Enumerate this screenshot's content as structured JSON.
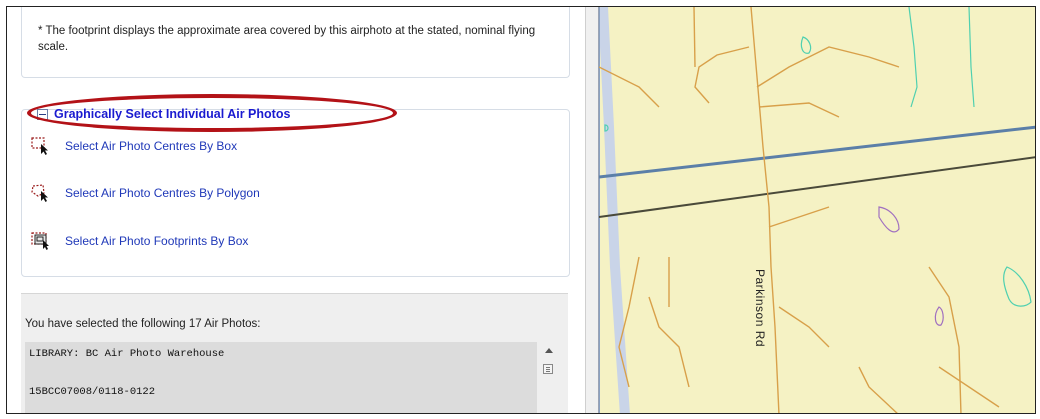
{
  "footprint_note": "* The footprint displays the approximate area covered by this airphoto at the stated, nominal flying scale.",
  "graphical_select": {
    "title": "Graphically Select Individual Air Photos",
    "tools": [
      {
        "label": "Select Air Photo Centres By Box",
        "icon": "select-by-box-icon"
      },
      {
        "label": "Select Air Photo Centres By Polygon",
        "icon": "select-by-polygon-icon"
      },
      {
        "label": "Select Air Photo Footprints By Box",
        "icon": "select-footprints-icon"
      }
    ]
  },
  "selection": {
    "summary": "You have selected the following 17 Air Photos:",
    "lines": [
      "LIBRARY: BC Air Photo Warehouse",
      "15BCC07008/0118-0122"
    ]
  },
  "map": {
    "road_label": "Parkinson Rd",
    "colors": {
      "background": "#f5f2c4",
      "road": "#d8a04a",
      "highway_blue": "#5b7fa8",
      "rail": "#4a4a3a",
      "water": "#4fd0b0",
      "purple": "#a070c0"
    }
  },
  "annotation_color": "#b31217"
}
